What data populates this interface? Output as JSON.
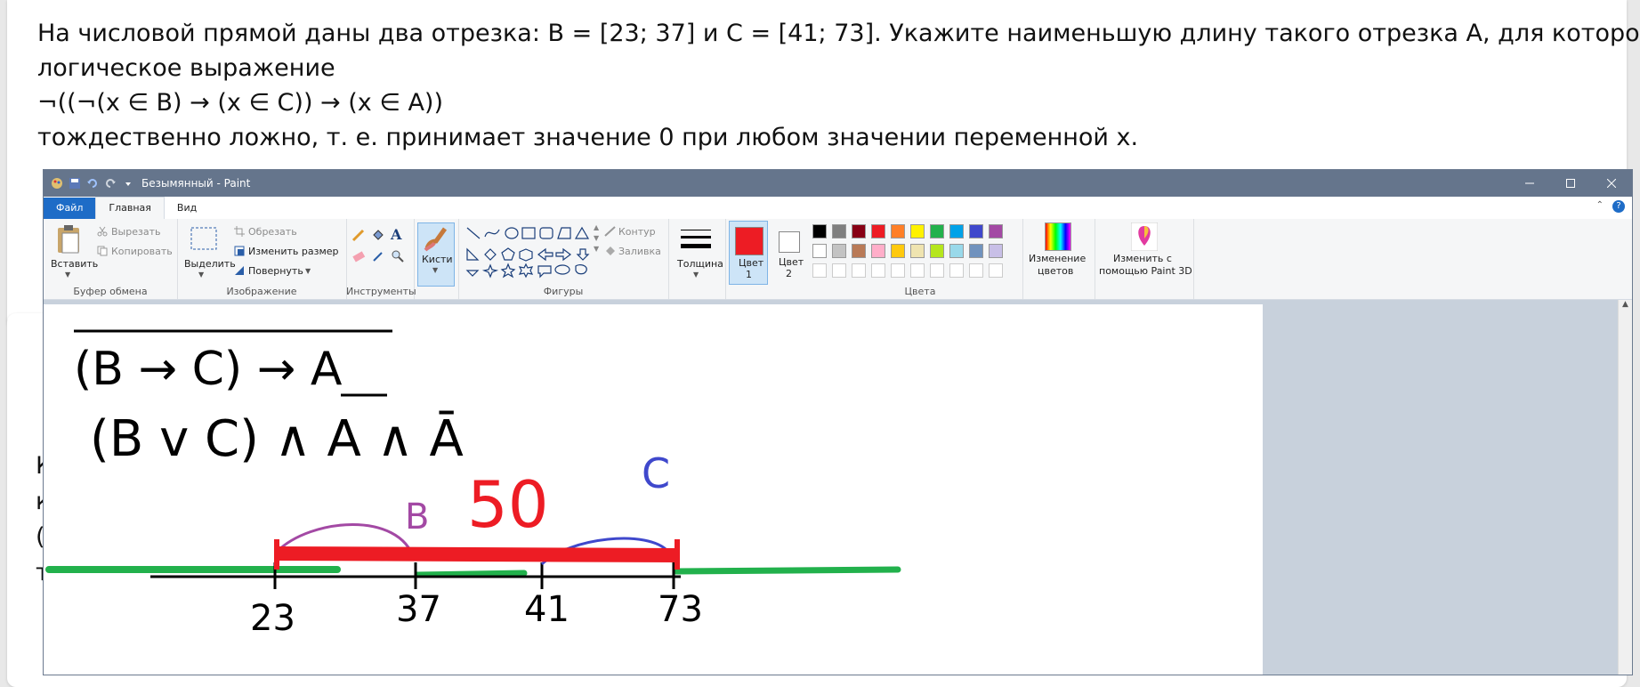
{
  "task": {
    "line1": "На числовой прямой даны два отрезка: B = [23; 37] и C = [41; 73]. Укажите наименьшую длину такого отрезка A, для которого",
    "line2": "логическое выражение",
    "line3": "¬((¬(x ∈ B) → (x ∈ C)) → (x ∈ A))",
    "line4": "тождественно ложно, т. е. принимает значение 0 при любом значении переменной x."
  },
  "peek": [
    "К",
    "к",
    "(",
    "т"
  ],
  "paint": {
    "title": "Безымянный - Paint",
    "tabs": {
      "file": "Файл",
      "home": "Главная",
      "view": "Вид"
    },
    "clipboard": {
      "paste": "Вставить",
      "cut": "Вырезать",
      "copy": "Копировать",
      "label": "Буфер обмена"
    },
    "image": {
      "select": "Выделить",
      "crop": "Обрезать",
      "resize": "Изменить размер",
      "rotate": "Повернуть",
      "label": "Изображение"
    },
    "tools": {
      "label": "Инструменты",
      "brushes": "Кисти"
    },
    "shapes": {
      "outline": "Контур",
      "fill": "Заливка",
      "label": "Фигуры"
    },
    "size": {
      "label": "Толщина"
    },
    "color1": {
      "label": "Цвет",
      "num": "1"
    },
    "color2": {
      "label": "Цвет",
      "num": "2"
    },
    "colors_label": "Цвета",
    "edit_colors": {
      "l1": "Изменение",
      "l2": "цветов"
    },
    "paint3d": {
      "l1": "Изменить с",
      "l2": "помощью Paint 3D"
    },
    "palette_row1": [
      "#000000",
      "#7f7f7f",
      "#880015",
      "#ed1c24",
      "#ff7f27",
      "#fff200",
      "#22b14c",
      "#00a2e8",
      "#3f48cc",
      "#a349a4"
    ],
    "palette_row2": [
      "#ffffff",
      "#c3c3c3",
      "#b97a57",
      "#ffaec9",
      "#ffc90e",
      "#efe4b0",
      "#b5e61d",
      "#99d9ea",
      "#7092be",
      "#c8bfe7"
    ]
  },
  "drawing": {
    "expr1": "(B → C) → A",
    "expr2": "(B v C) ∧ A ∧ Ā",
    "label_b": "B",
    "label_c": "C",
    "label_50": "50",
    "ticks": [
      "23",
      "37",
      "41",
      "73"
    ]
  }
}
